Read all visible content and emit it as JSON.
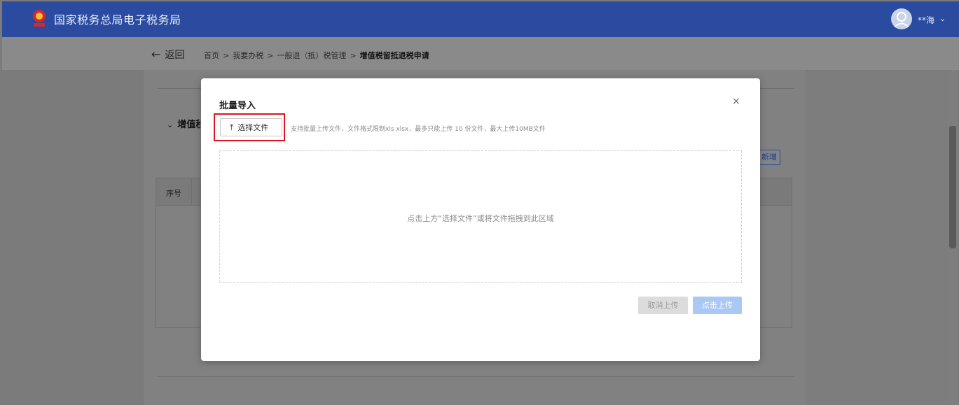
{
  "header": {
    "site_title": "国家税务总局电子税务局",
    "user_name": "**海",
    "logo_icon": "tax-emblem-icon",
    "avatar_icon": "user-avatar-icon",
    "chevron_icon": "chevron-down-icon"
  },
  "breadcrumb": {
    "back_label": "返回",
    "items": [
      "首页",
      "我要办税",
      "一般退（抵）税管理",
      "增值税留抵退税申请"
    ],
    "separator": ">"
  },
  "page": {
    "section_title": "增值税",
    "add_label": "新增",
    "table_columns": [
      "序号"
    ]
  },
  "modal": {
    "title": "批量导入",
    "close_label": "×",
    "choose_file_label": "选择文件",
    "upload_icon": "upload-arrow-icon",
    "upload_hint": "支持批量上传文件，文件格式限制xls xlsx，最多只能上传 10 份文件，最大上传10MB文件",
    "drop_hint": "点击上方“选择文件”或将文件拖拽到此区域",
    "cancel_label": "取消上传",
    "submit_label": "点击上传"
  },
  "colors": {
    "header_bg": "#2a4ba0",
    "highlight_border": "#e0141e",
    "primary_disabled": "#a9c8f3"
  }
}
